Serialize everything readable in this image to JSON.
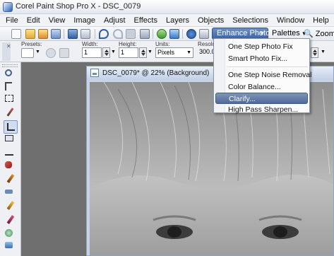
{
  "window": {
    "title": "Corel Paint Shop Pro X - DSC_0079"
  },
  "menubar": {
    "items": [
      "File",
      "Edit",
      "View",
      "Image",
      "Adjust",
      "Effects",
      "Layers",
      "Objects",
      "Selections",
      "Window",
      "Help"
    ]
  },
  "toolbar": {
    "enhance_photo_label": "Enhance Photo",
    "palettes_label": "Palettes",
    "zoom_label": "Zoom o"
  },
  "options_bar": {
    "presets_label": "Presets:",
    "width_label": "Width:",
    "width_value": "1",
    "height_label": "Height:",
    "height_value": "1",
    "units_label": "Units:",
    "units_value": "Pixels",
    "resolution_label": "Resolu",
    "resolution_value": "300.00"
  },
  "enhance_menu": {
    "items": [
      "One Step Photo Fix",
      "Smart Photo Fix...",
      "One Step Noise Removal",
      "Color Balance...",
      "Clarify...",
      "High Pass Sharpen..."
    ],
    "highlighted": "Clarify..."
  },
  "image_window": {
    "title": "DSC_0079* @  22% (Background)"
  },
  "colors": {
    "accent": "#3c62a3",
    "highlight": "#5b74a0",
    "workspace": "#6f6f6f"
  }
}
